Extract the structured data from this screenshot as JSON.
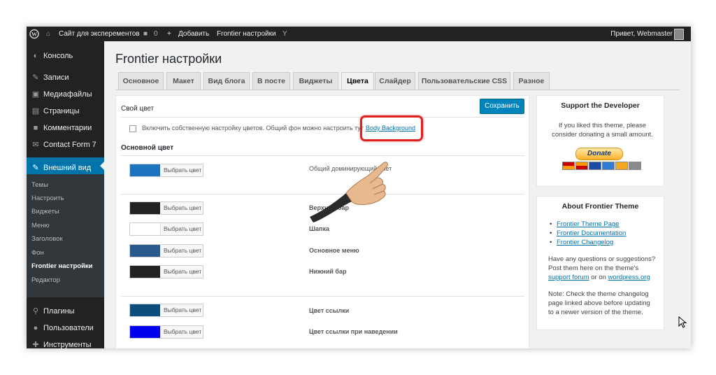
{
  "adminbar": {
    "site_name": "Сайт для эксперементов",
    "comments_count": "0",
    "add_label": "Добавить",
    "theme_settings": "Frontier настройки",
    "greeting": "Привет, Webmaster"
  },
  "sidebar": {
    "items": [
      {
        "label": "Консоль",
        "icon": "dashboard-icon"
      },
      {
        "label": "Записи",
        "icon": "pin-icon"
      },
      {
        "label": "Медиафайлы",
        "icon": "media-icon"
      },
      {
        "label": "Страницы",
        "icon": "pages-icon"
      },
      {
        "label": "Комментарии",
        "icon": "comments-icon"
      },
      {
        "label": "Contact Form 7",
        "icon": "mail-icon"
      },
      {
        "label": "Внешний вид",
        "icon": "brush-icon"
      },
      {
        "label": "Плагины",
        "icon": "plugin-icon"
      },
      {
        "label": "Пользователи",
        "icon": "users-icon"
      },
      {
        "label": "Инструменты",
        "icon": "tools-icon"
      }
    ],
    "submenu": [
      "Темы",
      "Настроить",
      "Виджеты",
      "Меню",
      "Заголовок",
      "Фон",
      "Frontier настройки",
      "Редактор"
    ],
    "active_color": "#0073aa"
  },
  "page": {
    "title": "Frontier настройки",
    "tabs": [
      "Основное",
      "Макет",
      "Вид блога",
      "В посте",
      "Виджеты",
      "Цвета",
      "Слайдер",
      "Пользовательские CSS",
      "Разное"
    ],
    "active_tab": "Цвета"
  },
  "panel": {
    "heading": "Свой цвет",
    "save_label": "Сохранить",
    "checkbox_label": "Включить собственную настройку цветов. Общий фон можно настроить тут",
    "checkbox_checked": false,
    "body_bg_link": "Body Background",
    "section_title": "Основной цвет",
    "pick_label": "Выбрать цвет",
    "rows": [
      {
        "label": "Общий доминирующий цвет",
        "color": "#1e73be"
      },
      {
        "label": "Верхний бар",
        "color": "#222222"
      },
      {
        "label": "Шапка",
        "color": "#ffffff"
      },
      {
        "label": "Основное меню",
        "color": "#2a5a8c"
      },
      {
        "label": "Нижний бар",
        "color": "#222222"
      },
      {
        "label": "Цвет ссылки",
        "color": "#0e4d7b"
      },
      {
        "label": "Цвет ссылки при наведении",
        "color": "#0000ee"
      }
    ]
  },
  "support_box": {
    "title": "Support the Developer",
    "text": "If you liked this theme, please consider donating a small amount.",
    "donate_label": "Donate"
  },
  "about_box": {
    "title": "About Frontier Theme",
    "links": [
      "Frontier Theme Page",
      "Frontier Documentation",
      "Frontier Changelog"
    ],
    "q_text_before": "Have any questions or suggestions? Post them here on the theme's",
    "support_forum": "support forum",
    "or_on": "or on",
    "wordpress_org": "wordpress.org",
    "note": "Note: Check the theme changelog page linked above before updating to a newer version of the theme."
  }
}
